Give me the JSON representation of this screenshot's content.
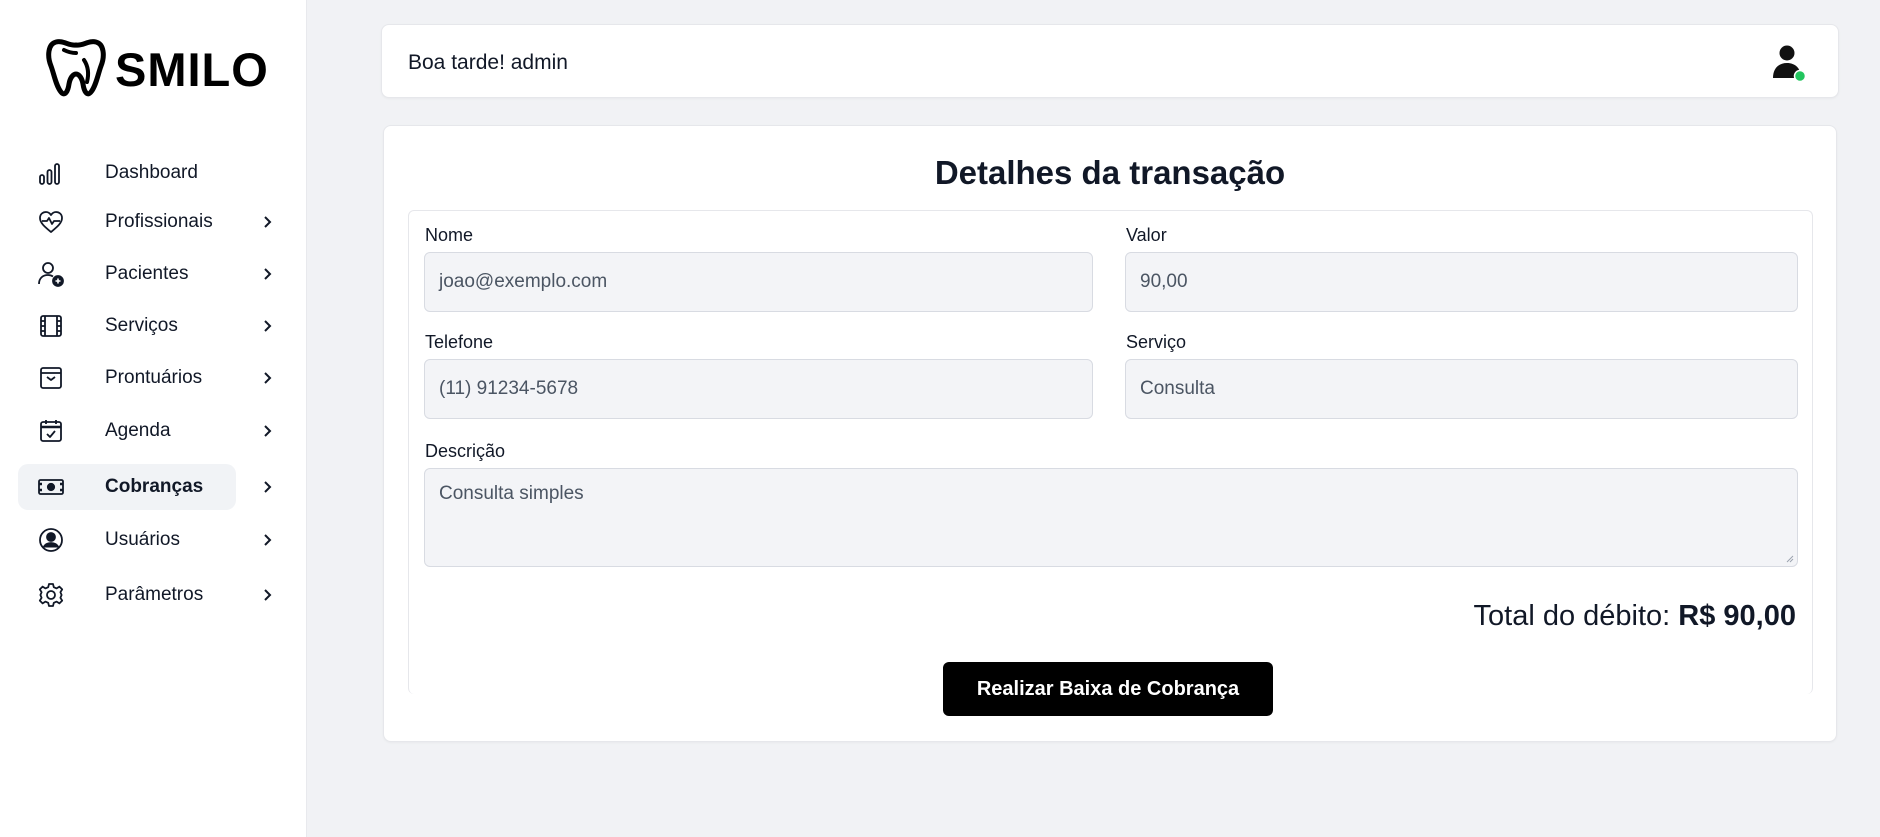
{
  "brand": {
    "name": "SMILO"
  },
  "sidebar": {
    "items": [
      {
        "label": "Dashboard",
        "icon": "bar-chart-icon",
        "has_chevron": false,
        "active": false
      },
      {
        "label": "Profissionais",
        "icon": "heart-pulse-icon",
        "has_chevron": true,
        "active": false
      },
      {
        "label": "Pacientes",
        "icon": "user-plus-icon",
        "has_chevron": true,
        "active": false
      },
      {
        "label": "Serviços",
        "icon": "film-icon",
        "has_chevron": true,
        "active": false
      },
      {
        "label": "Prontuários",
        "icon": "archive-icon",
        "has_chevron": true,
        "active": false
      },
      {
        "label": "Agenda",
        "icon": "calendar-check-icon",
        "has_chevron": true,
        "active": false
      },
      {
        "label": "Cobranças",
        "icon": "banknote-icon",
        "has_chevron": true,
        "active": true
      },
      {
        "label": "Usuários",
        "icon": "user-circle-icon",
        "has_chevron": true,
        "active": false
      },
      {
        "label": "Parâmetros",
        "icon": "gear-icon",
        "has_chevron": true,
        "active": false
      }
    ]
  },
  "header": {
    "greeting": "Boa tarde! admin",
    "avatar_status_color": "#22c55e"
  },
  "transaction": {
    "title": "Detalhes da transação",
    "fields": {
      "nome": {
        "label": "Nome",
        "value": "joao@exemplo.com"
      },
      "valor": {
        "label": "Valor",
        "value": "90,00"
      },
      "telefone": {
        "label": "Telefone",
        "value": "(11) 91234-5678"
      },
      "servico": {
        "label": "Serviço",
        "value": "Consulta"
      },
      "descricao": {
        "label": "Descrição",
        "value": "Consulta simples"
      }
    },
    "total_label": "Total do débito:",
    "total_value": "R$ 90,00",
    "action_label": "Realizar Baixa de Cobrança"
  },
  "colors": {
    "page_bg": "#f1f2f5",
    "primary_button": "#000000",
    "text": "#111827",
    "online": "#22c55e"
  }
}
